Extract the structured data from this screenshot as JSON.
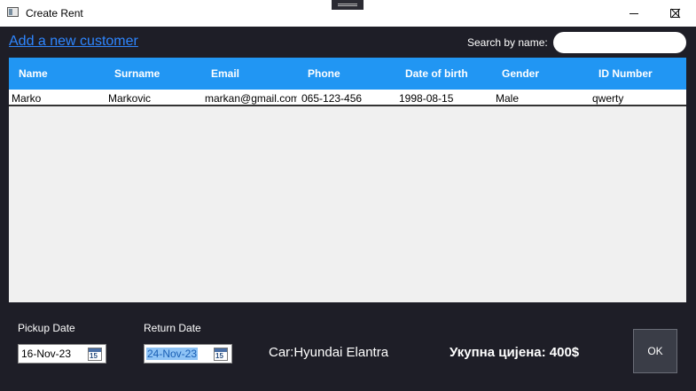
{
  "window": {
    "title": "Create Rent"
  },
  "actions": {
    "add_customer": "Add a new customer"
  },
  "search": {
    "label": "Search by name:",
    "value": ""
  },
  "table": {
    "columns": [
      "Name",
      "Surname",
      "Email",
      "Phone",
      "Date of birth",
      "Gender",
      "ID Number"
    ],
    "rows": [
      [
        "Marko",
        "Markovic",
        "markan@gmail.com",
        "065-123-456",
        "1998-08-15",
        "Male",
        "qwerty"
      ]
    ]
  },
  "rent": {
    "pickup_label": "Pickup Date",
    "pickup_value": "16-Nov-23",
    "return_label": "Return Date",
    "return_value": "24-Nov-23",
    "calendar_glyph": "15",
    "car": "Car:Hyundai Elantra",
    "price": "Укупна цијена: 400$",
    "ok_label": "OK"
  },
  "colors": {
    "accent": "#2196f3",
    "background": "#1e1e27",
    "link": "#2e86ff"
  },
  "icons": [
    "app-icon",
    "minimize-icon",
    "maximize-icon",
    "close-icon",
    "calendar-icon"
  ]
}
